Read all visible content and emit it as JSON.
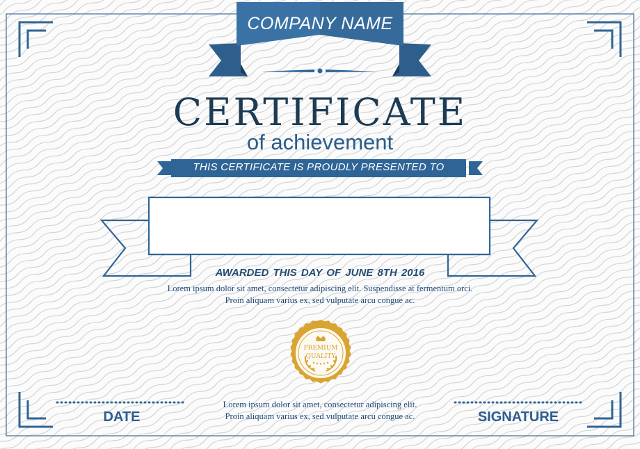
{
  "certificate": {
    "company_name": "COMPANY NAME",
    "title": "CERTIFICATE",
    "subtitle": "of achievement",
    "presented_to": "THIS CERTIFICATE IS PROUDLY PRESENTED TO",
    "recipient_name": "",
    "awarded": "AWARDED THIS  DAY OF  JUNE  8TH  2016",
    "body_line_1": "Lorem ipsum dolor sit amet, consectetur adipiscing elit. Suspendisse at fermentum orci.",
    "body_line_2": "Proin aliquam varius ex, sed vulputate arcu congue ac.",
    "footer_line_1": "Lorem ipsum dolor sit amet, consectetur adipiscing elit.",
    "footer_line_2": "Proin aliquam varius ex, sed vulputate arcu congue ac.",
    "date_label": "DATE",
    "signature_label": "SIGNATURE"
  },
  "seal": {
    "top_text": "PREMIUM",
    "bottom_text": "QUALITY"
  },
  "colors": {
    "primary_blue": "#2f6596",
    "dark_navy": "#1c3b54",
    "gold": "#d9a431",
    "background": "#fbfbfb"
  }
}
